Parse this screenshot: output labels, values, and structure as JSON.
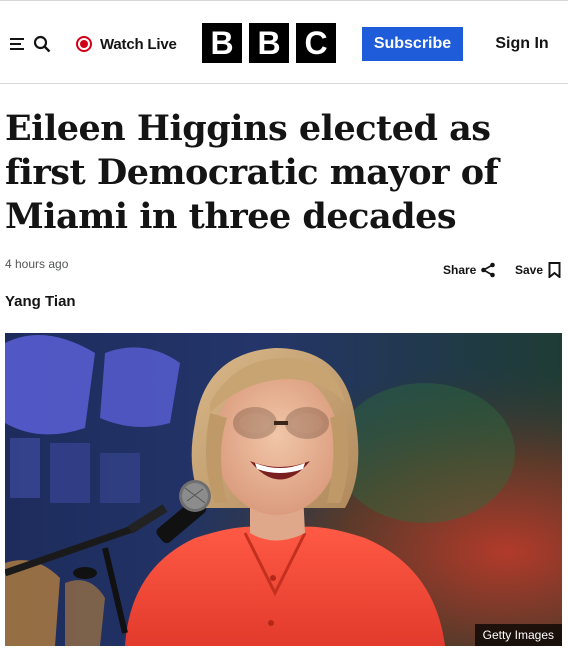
{
  "header": {
    "watch_live_label": "Watch Live",
    "logo_letters": [
      "B",
      "B",
      "C"
    ],
    "subscribe_label": "Subscribe",
    "signin_label": "Sign In"
  },
  "article": {
    "headline": "Eileen Higgins elected as first Democratic mayor of Miami in three decades",
    "timestamp": "4 hours ago",
    "share_label": "Share",
    "save_label": "Save",
    "byline": "Yang Tian",
    "image_credit": "Getty Images"
  },
  "icons": {
    "menu": "menu-search-icon",
    "live": "live-dot-icon",
    "share": "share-icon",
    "save": "bookmark-icon"
  },
  "colors": {
    "subscribe_bg": "#1f5cd9",
    "live_red": "#d10016",
    "logo_bg": "#000000"
  }
}
